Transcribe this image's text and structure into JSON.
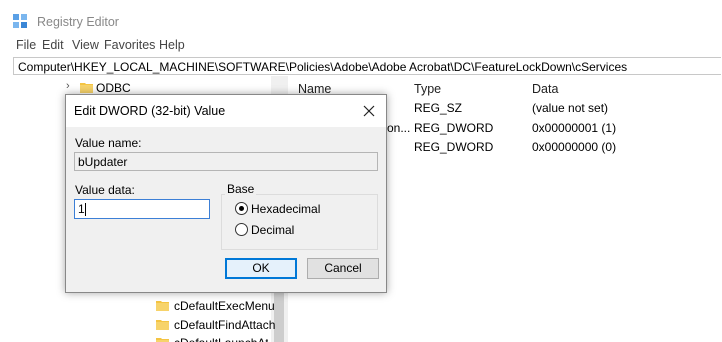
{
  "window": {
    "title": "Registry Editor",
    "menu": [
      "File",
      "Edit",
      "View",
      "Favorites",
      "Help"
    ],
    "address": "Computer\\HKEY_LOCAL_MACHINE\\SOFTWARE\\Policies\\Adobe\\Adobe Acrobat\\DC\\FeatureLockDown\\cServices"
  },
  "tree": {
    "items": [
      {
        "label": "ODBC"
      },
      {
        "label": "cDefaultExecMenu"
      },
      {
        "label": "cDefaultFindAttach"
      },
      {
        "label": "cDefaultLaunchAtt"
      }
    ]
  },
  "list": {
    "columns": [
      "Name",
      "Type",
      "Data"
    ],
    "rows": [
      {
        "name": "",
        "type": "REG_SZ",
        "data": "(value not set)"
      },
      {
        "name": "on...",
        "type": "REG_DWORD",
        "data": "0x00000001 (1)"
      },
      {
        "name": "",
        "type": "REG_DWORD",
        "data": "0x00000000 (0)"
      }
    ]
  },
  "dialog": {
    "title": "Edit DWORD (32-bit) Value",
    "value_name_label": "Value name:",
    "value_name": "bUpdater",
    "value_data_label": "Value data:",
    "value_data": "1",
    "base_label": "Base",
    "hex_label": "Hexadecimal",
    "dec_label": "Decimal",
    "selected_base": "Hexadecimal",
    "ok_label": "OK",
    "cancel_label": "Cancel"
  },
  "colors": {
    "accent": "#0078d7",
    "folder": "#f4c443",
    "dialog_bg": "#f0f0f0"
  }
}
